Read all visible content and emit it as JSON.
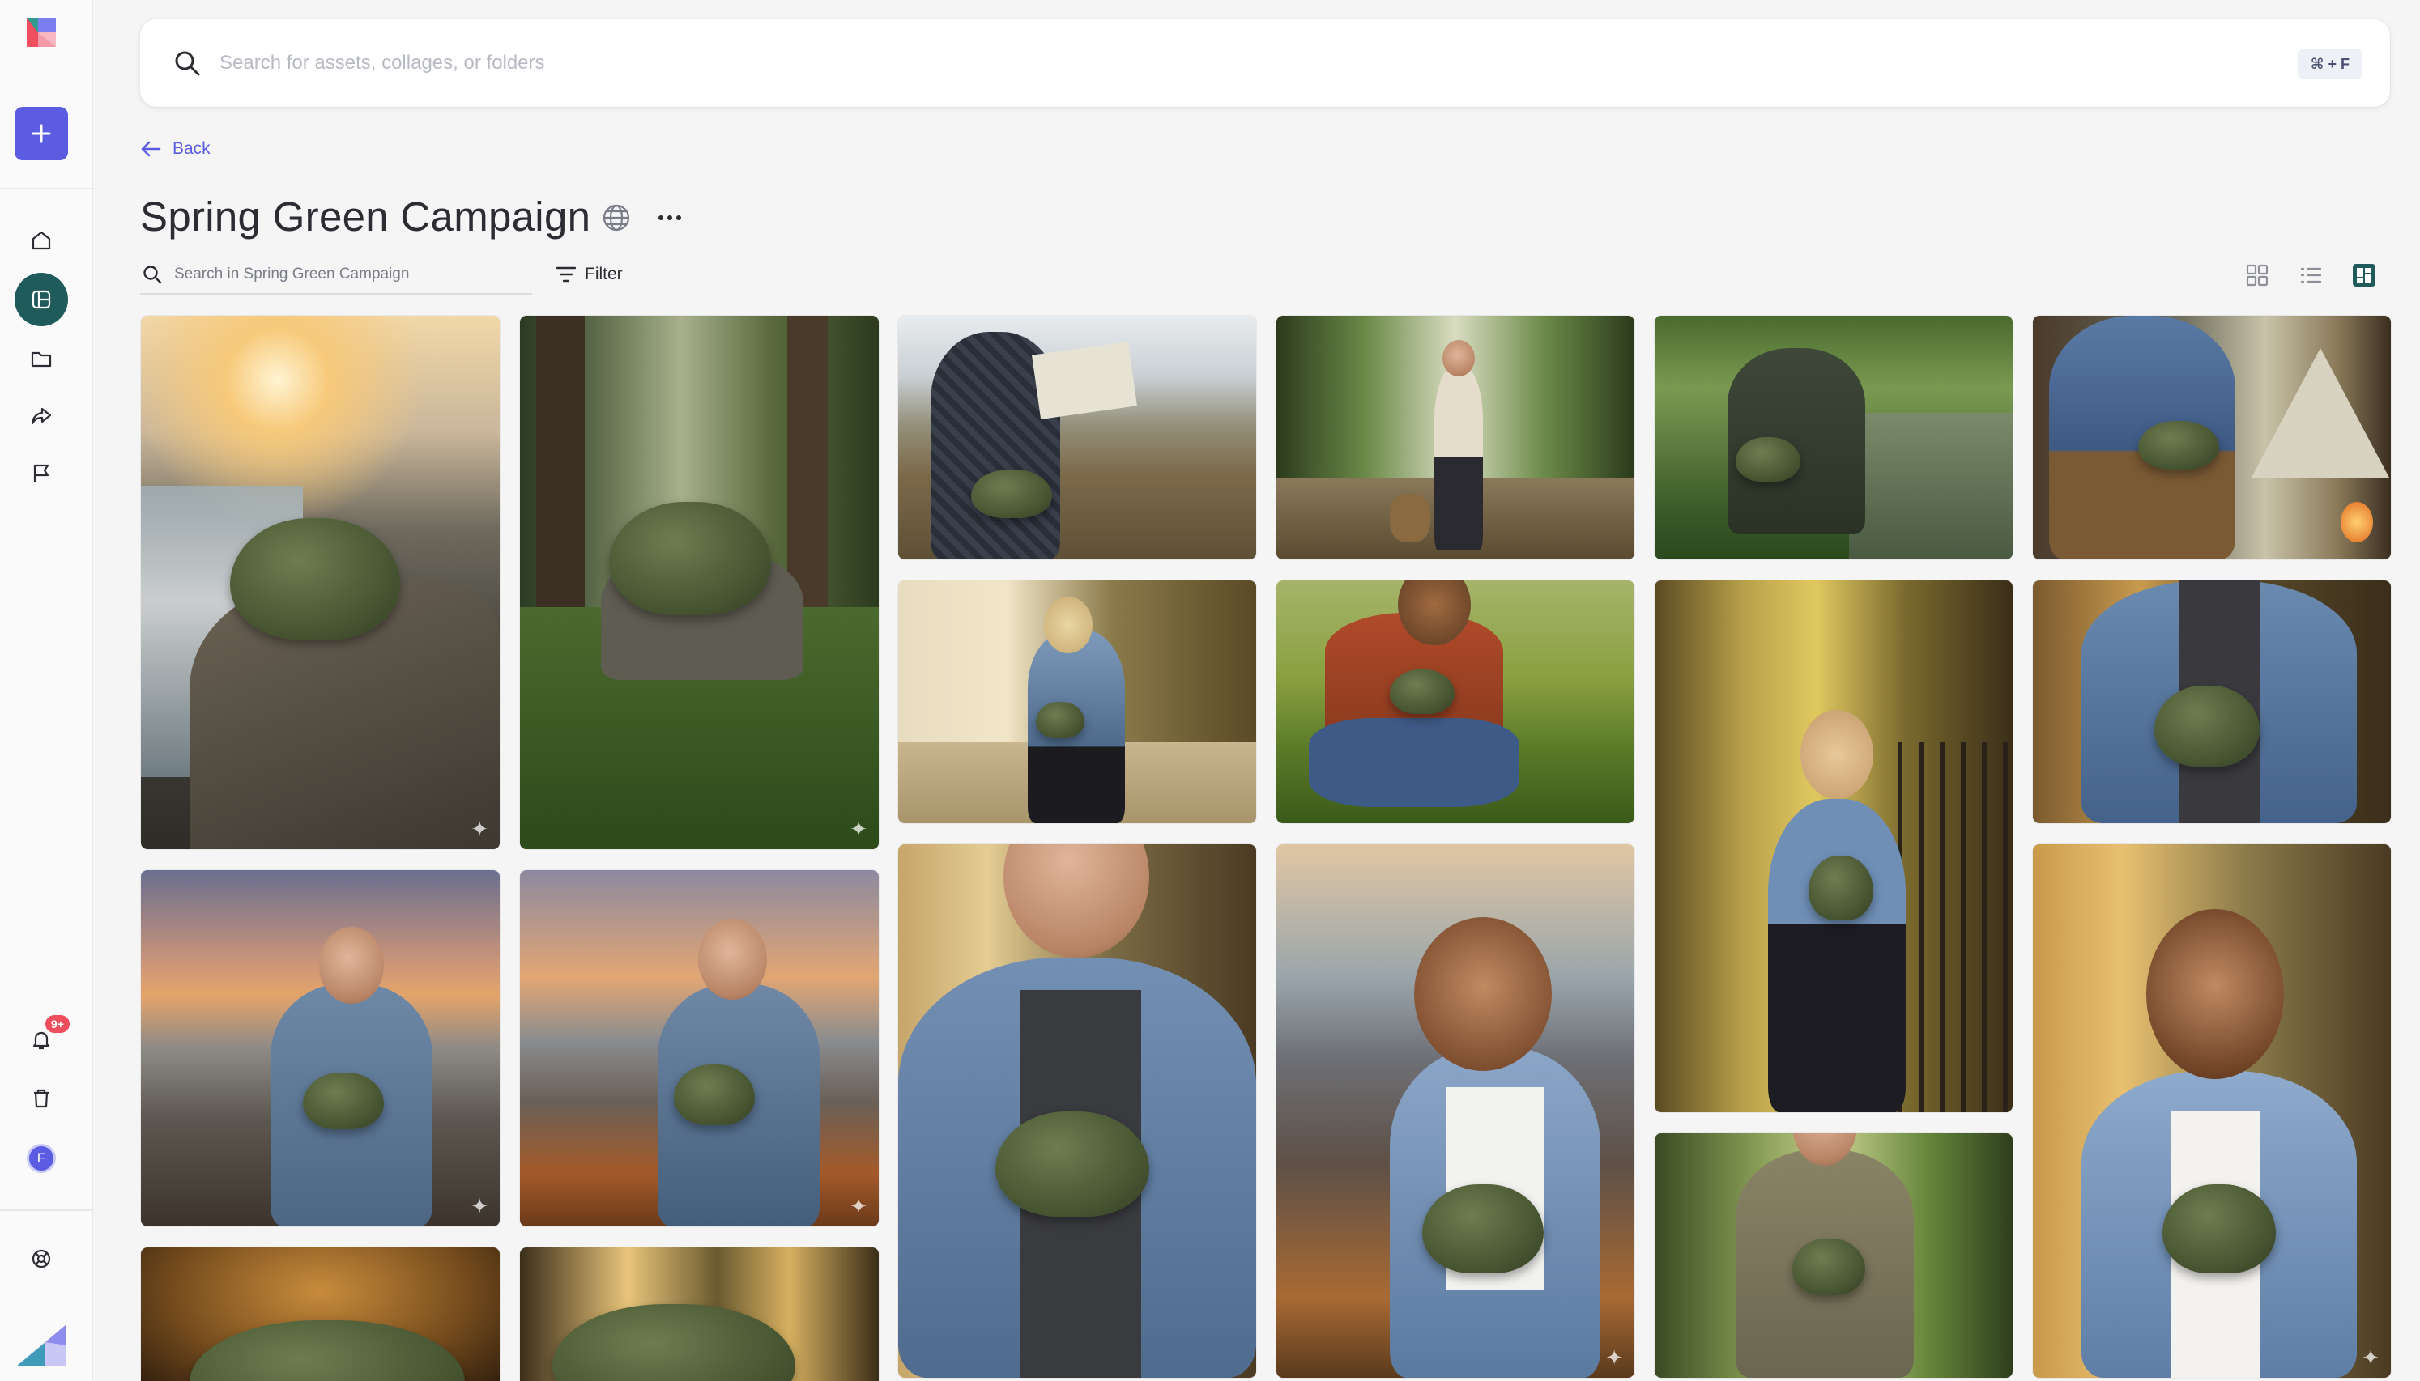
{
  "search": {
    "placeholder": "Search for assets, collages, or folders",
    "shortcut": "⌘ + F"
  },
  "nav": {
    "back_label": "Back",
    "notifications_badge": "9+",
    "avatar_initial": "F"
  },
  "collection": {
    "title": "Spring Green Campaign",
    "search_placeholder": "Search in Spring Green Campaign",
    "filter_label": "Filter"
  },
  "colors": {
    "accent": "#5b5ce2",
    "active_nav": "#1f5b5a",
    "badge": "#ef4e5e"
  },
  "icons": {
    "sidebar": [
      "home-icon",
      "collections-icon",
      "folder-icon",
      "share-icon",
      "flag-icon",
      "bell-icon",
      "trash-icon",
      "help-icon"
    ],
    "views": [
      "grid-view-icon",
      "list-view-icon",
      "masonry-view-icon"
    ]
  },
  "assets": [
    {
      "name": "fanny-pack-on-sea-rocks-sunset"
    },
    {
      "name": "fanny-pack-on-mossy-forest-rock"
    },
    {
      "name": "hiker-with-map-on-cliff"
    },
    {
      "name": "woman-walking-dog-forest-trail"
    },
    {
      "name": "photographer-by-forest-stream"
    },
    {
      "name": "man-at-campsite-tent"
    },
    {
      "name": "woman-in-autumn-park"
    },
    {
      "name": "man-crouching-mushrooms"
    },
    {
      "name": "woman-by-iron-fence"
    },
    {
      "name": "man-denim-jacket-crossbody"
    },
    {
      "name": "man-on-coastal-rocks"
    },
    {
      "name": "man-looking-out-coast"
    },
    {
      "name": "man-denim-closeup-forest"
    },
    {
      "name": "woman-coastal-sunset"
    },
    {
      "name": "man-tshirt-forest"
    },
    {
      "name": "woman-smiling-forest"
    },
    {
      "name": "fanny-pack-studio"
    },
    {
      "name": "fanny-pack-forest-sunlight"
    }
  ]
}
